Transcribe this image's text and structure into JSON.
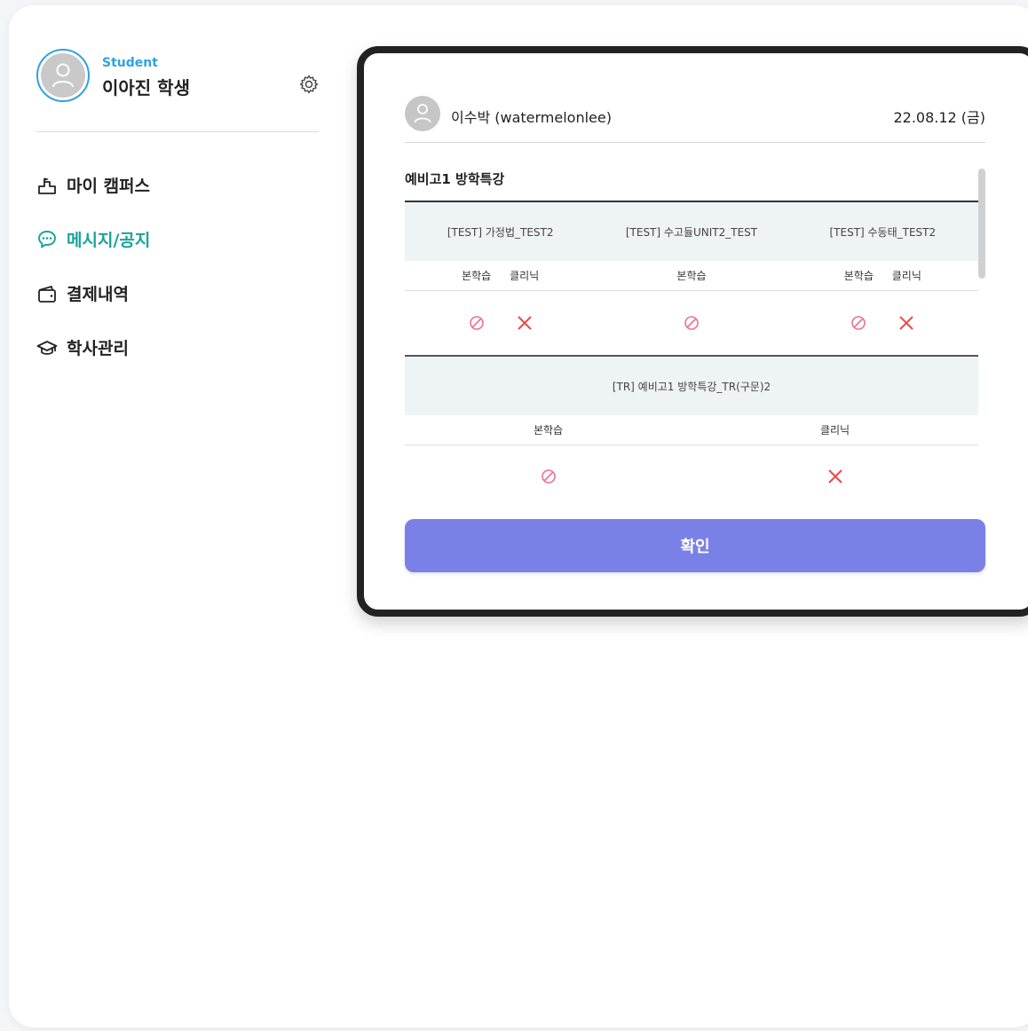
{
  "profile": {
    "role": "Student",
    "name": "이아진 학생"
  },
  "nav": {
    "items": [
      {
        "label": "마이 캠퍼스",
        "icon": "campus-icon",
        "active": false
      },
      {
        "label": "메시지/공지",
        "icon": "chat-bubble-icon",
        "active": true
      },
      {
        "label": "결제내역",
        "icon": "wallet-icon",
        "active": false
      },
      {
        "label": "학사관리",
        "icon": "graduation-cap-icon",
        "active": false
      }
    ]
  },
  "colors": {
    "accent_blue": "#2fa3e0",
    "active_green": "#1aa39a",
    "button_purple": "#7a81e6",
    "mark_pink": "#ee6f96",
    "mark_red": "#e84848"
  },
  "message": {
    "sender": "이수박 (watermelonlee)",
    "date": "22.08.12 (금)",
    "section_title": "예비고1 방학특강",
    "courses_group1": [
      {
        "name": "[TEST] 가정법_TEST2",
        "labels": [
          "본학습",
          "클리닉"
        ],
        "marks": [
          "none",
          "fail"
        ]
      },
      {
        "name": "[TEST] 수고듈UNIT2_TEST",
        "labels": [
          "본학습"
        ],
        "marks": [
          "none"
        ]
      },
      {
        "name": "[TEST] 수동태_TEST2",
        "labels": [
          "본학습",
          "클리닉"
        ],
        "marks": [
          "none",
          "fail"
        ]
      }
    ],
    "course_group2": {
      "name": "[TR] 예비고1 방학특강_TR(구문)2",
      "labels": [
        "본학습",
        "클리닉"
      ],
      "marks": [
        "none",
        "fail"
      ]
    },
    "confirm_label": "확인"
  }
}
